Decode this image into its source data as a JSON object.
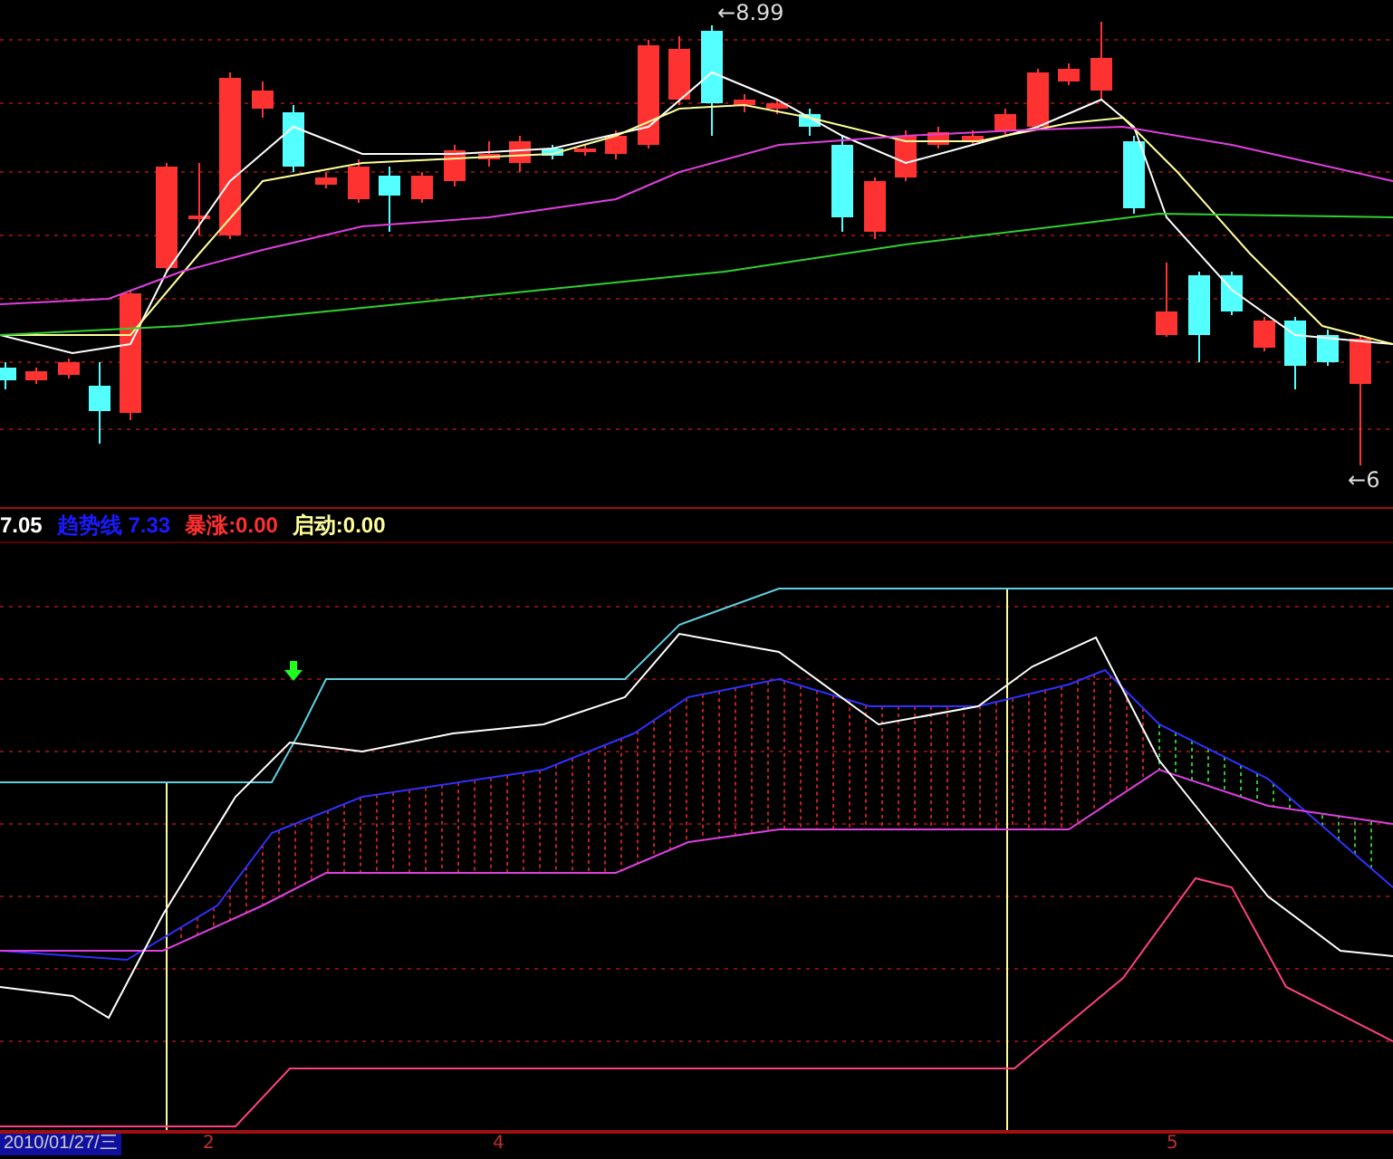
{
  "price_chart": {
    "high_label": {
      "arrow": "←",
      "value": "8.99"
    },
    "low_label": {
      "arrow": "←",
      "value": "6"
    }
  },
  "legend": [
    {
      "text": "7.05"
    },
    {
      "text": "趋势线 7.33"
    },
    {
      "text": "暴涨:0.00"
    },
    {
      "text": "启动:0.00"
    }
  ],
  "time_axis": {
    "date": "2010/01/27/三",
    "ticks": [
      "2",
      "4",
      "5"
    ]
  }
}
